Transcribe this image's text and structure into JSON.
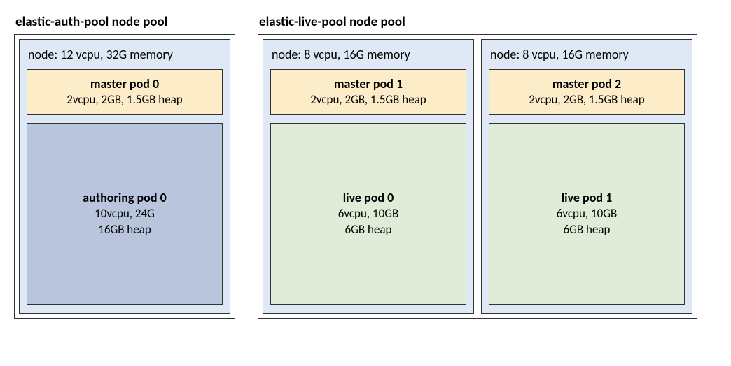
{
  "pools": [
    {
      "title": "elastic-auth-pool node pool",
      "nodes": [
        {
          "label": "node: 12 vcpu, 32G memory",
          "pods": [
            {
              "kind": "master",
              "title": "master pod 0",
              "spec1": "2vcpu, 2GB, 1.5GB heap"
            },
            {
              "kind": "authoring",
              "title": "authoring pod 0",
              "spec1": "10vcpu, 24G",
              "spec2": "16GB heap"
            }
          ]
        }
      ]
    },
    {
      "title": "elastic-live-pool node pool",
      "nodes": [
        {
          "label": "node: 8 vcpu, 16G memory",
          "pods": [
            {
              "kind": "master",
              "title": "master pod 1",
              "spec1": "2vcpu, 2GB, 1.5GB heap"
            },
            {
              "kind": "live",
              "title": "live pod 0",
              "spec1": "6vcpu, 10GB",
              "spec2": "6GB heap"
            }
          ]
        },
        {
          "label": "node: 8 vcpu, 16G memory",
          "pods": [
            {
              "kind": "master",
              "title": "master pod 2",
              "spec1": "2vcpu, 2GB, 1.5GB heap"
            },
            {
              "kind": "live",
              "title": "live pod 1",
              "spec1": "6vcpu, 10GB",
              "spec2": "6GB heap"
            }
          ]
        }
      ]
    }
  ]
}
